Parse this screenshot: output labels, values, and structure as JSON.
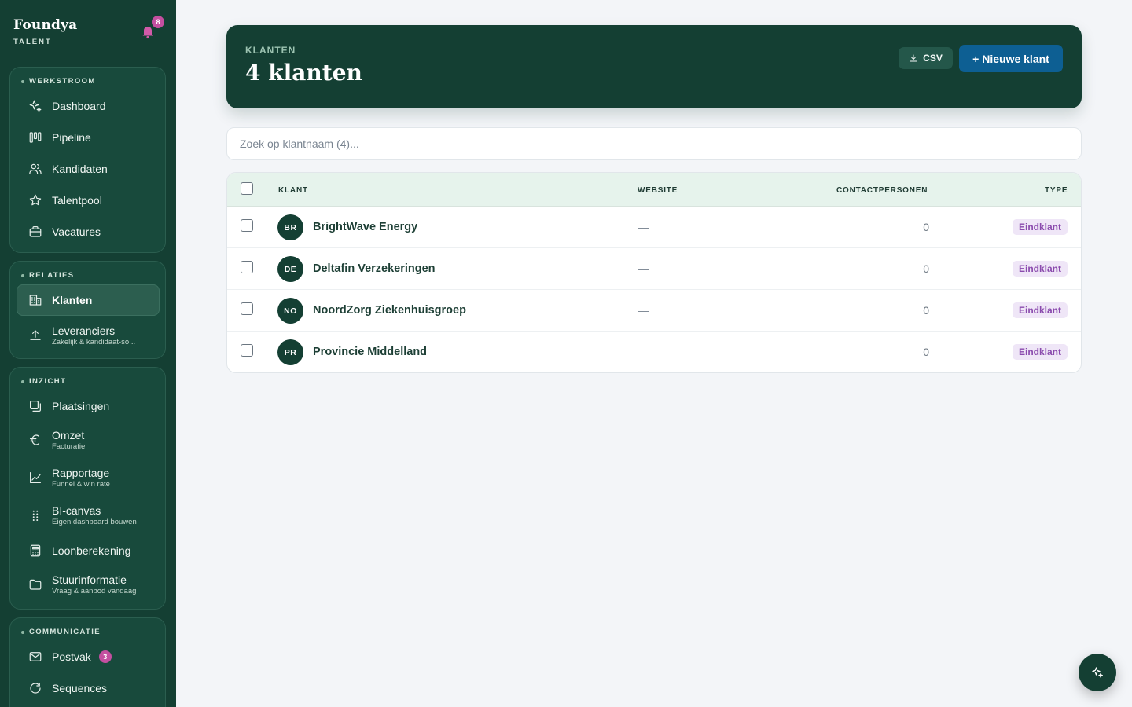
{
  "brand": {
    "name": "Foundya",
    "sub": "TALENT",
    "notification_count": "8"
  },
  "sidebar": {
    "werkstroom": {
      "title": "WERKSTROOM",
      "items": [
        {
          "label": "Dashboard",
          "icon": "sparkle-icon"
        },
        {
          "label": "Pipeline",
          "icon": "kanban-icon"
        },
        {
          "label": "Kandidaten",
          "icon": "users-icon"
        },
        {
          "label": "Talentpool",
          "icon": "star-icon"
        },
        {
          "label": "Vacatures",
          "icon": "briefcase-icon"
        }
      ]
    },
    "relaties": {
      "title": "RELATIES",
      "items": [
        {
          "label": "Klanten",
          "icon": "building-icon",
          "active": true
        },
        {
          "label": "Leveranciers",
          "sub": "Zakelijk & kandidaat-so...",
          "icon": "upload-icon"
        }
      ]
    },
    "inzicht": {
      "title": "INZICHT",
      "items": [
        {
          "label": "Plaatsingen",
          "icon": "copy-icon"
        },
        {
          "label": "Omzet",
          "sub": "Facturatie",
          "icon": "euro-icon"
        },
        {
          "label": "Rapportage",
          "sub": "Funnel & win rate",
          "icon": "line-chart-icon"
        },
        {
          "label": "BI-canvas",
          "sub": "Eigen dashboard bouwen",
          "icon": "grip-icon"
        },
        {
          "label": "Loonberekening",
          "icon": "calculator-icon"
        },
        {
          "label": "Stuurinformatie",
          "sub": "Vraag & aanbod vandaag",
          "icon": "folder-icon"
        }
      ]
    },
    "communicatie": {
      "title": "COMMUNICATIE",
      "items": [
        {
          "label": "Postvak",
          "icon": "mail-icon",
          "badge": "3"
        },
        {
          "label": "Sequences",
          "icon": "refresh-icon"
        }
      ]
    }
  },
  "header": {
    "eyebrow": "KLANTEN",
    "title": "4 klanten",
    "csv_label": "CSV",
    "new_label": "+ Nieuwe klant"
  },
  "search": {
    "placeholder": "Zoek op klantnaam (4)..."
  },
  "table": {
    "columns": {
      "klant": "KLANT",
      "website": "WEBSITE",
      "contacten": "CONTACTPERSONEN",
      "type": "TYPE"
    },
    "rows": [
      {
        "initials": "BR",
        "name": "BrightWave Energy",
        "website": "—",
        "contacts": "0",
        "type": "Eindklant"
      },
      {
        "initials": "DE",
        "name": "Deltafin Verzekeringen",
        "website": "—",
        "contacts": "0",
        "type": "Eindklant"
      },
      {
        "initials": "NO",
        "name": "NoordZorg Ziekenhuisgroep",
        "website": "—",
        "contacts": "0",
        "type": "Eindklant"
      },
      {
        "initials": "PR",
        "name": "Provincie Middelland",
        "website": "—",
        "contacts": "0",
        "type": "Eindklant"
      }
    ]
  },
  "colors": {
    "sidebar": "#143f33",
    "primary_button": "#0d5f93",
    "badge": "#c44fa0",
    "type_badge_text": "#8a4aad"
  }
}
